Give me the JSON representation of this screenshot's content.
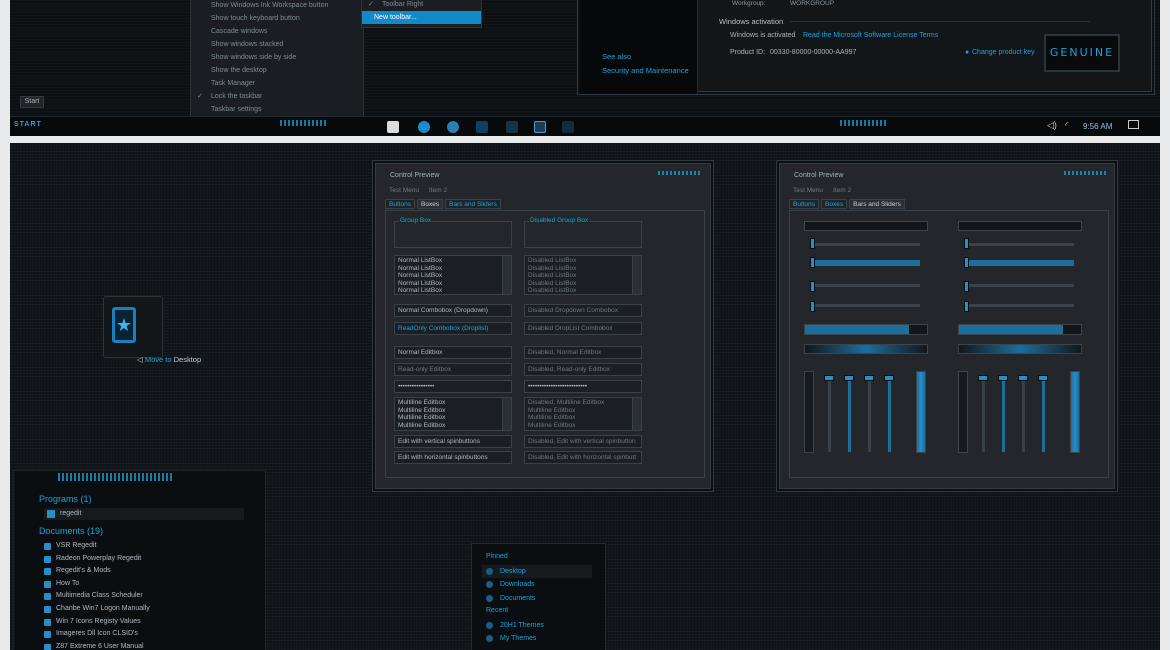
{
  "context_menu": {
    "items": [
      {
        "label": "Show Windows Ink Workspace button",
        "checked": false
      },
      {
        "label": "Show touch keyboard button",
        "checked": false
      },
      {
        "label": "Cascade windows",
        "checked": false
      },
      {
        "label": "Show windows stacked",
        "checked": false
      },
      {
        "label": "Show windows side by side",
        "checked": false
      },
      {
        "label": "Show the desktop",
        "checked": false
      },
      {
        "label": "Task Manager",
        "checked": false
      },
      {
        "label": "Lock the taskbar",
        "checked": true
      },
      {
        "label": "Taskbar settings",
        "checked": false
      }
    ],
    "check_mark": "✓"
  },
  "submenu": {
    "items": [
      {
        "label": "Toolbar Right",
        "checked": true
      },
      {
        "label": "New toolbar...",
        "highlighted": true
      }
    ]
  },
  "start_tooltip": "Start",
  "taskbar": {
    "start_label": "START",
    "time": "9:56 AM"
  },
  "system": {
    "workgroup_label": "Workgroup:",
    "workgroup_value": "WORKGROUP",
    "see_also": "See also",
    "security_link": "Security and Maintenance",
    "activation_header": "Windows activation",
    "activation_status": "Windows is activated",
    "license_link": "Read the Microsoft Software License Terms",
    "product_id_label": "Product ID:",
    "product_id": "00330-80000-00000-AA997",
    "change_key": "Change product key",
    "genuine": "GENUINE"
  },
  "desktop_icon": {
    "label": "Move to Desktop",
    "move_word": "Move to",
    "dest_word": "Desktop"
  },
  "preview1": {
    "title": "Control Preview",
    "menu": [
      "Test Menu",
      "Item 2"
    ],
    "tabs": [
      "Buttons",
      "Boxes",
      "Bars and Sliders"
    ],
    "group_box": "Group Box",
    "disabled_group_box": "Disabled Group Box",
    "normal_listbox_items": [
      "Normal ListBox",
      "Normal ListBox",
      "Normal ListBox",
      "Normal ListBox",
      "Normal ListBox"
    ],
    "disabled_listbox_items": [
      "Disabled ListBox",
      "Disabled ListBox",
      "Disabled ListBox",
      "Disabled ListBox",
      "Disabled ListBox"
    ],
    "combo_normal": "Normal Combobox (Dropdown)",
    "combo_disabled": "Disabled Dropdown Combobox",
    "combo_readonly": "ReadOnly Combobox (Droplist)",
    "combo_disabled_droplist": "Disabled DropList Combobox",
    "edit_normal": "Normal Editbox",
    "edit_disabled": "Disabled, Normal Editbox",
    "edit_readonly": "Read-only Editbox",
    "edit_disabled_readonly": "Disabled, Read-only Editbox",
    "password": "••••••••••••••••",
    "password_disabled": "••••••••••••••••••••••••••",
    "multiline_items": [
      "Multiline Editbox",
      "Multiline Editbox",
      "Multiline Editbox",
      "Multiline Editbox"
    ],
    "multiline_disabled_items": [
      "Disabled, Multiline Editbox",
      "Multiline Editbox",
      "Multiline Editbox",
      "Multiline Editbox"
    ],
    "spin_vertical": "Edit with vertical spinbuttons",
    "spin_vertical_disabled": "Disabled, Edit with vertical spinbutton",
    "spin_horizontal": "Edit with horizontal spinbuttons",
    "spin_horizontal_disabled": "Disabled, Edit with horizontal spinbutt"
  },
  "preview2": {
    "title": "Control Preview",
    "menu": [
      "Test Menu",
      "Item 2"
    ],
    "tabs": [
      "Buttons",
      "Boxes",
      "Bars and Sliders"
    ],
    "progress_fill": 0.85
  },
  "search_results": {
    "programs_header": "Programs (1)",
    "program_items": [
      "regedit"
    ],
    "documents_header": "Documents (19)",
    "document_items": [
      "VSR Regedit",
      "Radeon Powerplay Regedit",
      "Regedit's & Mods",
      "How To",
      "Multimedia Class Scheduler",
      "Chanbe Win7 Logon Manually",
      "Win 7 Icons Registy Values",
      "Imageres Dll Icon CLSID's",
      "Z87 Extreme 6 User Manual"
    ]
  },
  "jumplist": {
    "pinned_header": "Pinned",
    "pinned_items": [
      "Desktop",
      "Downloads",
      "Documents"
    ],
    "recent_header": "Recent",
    "recent_items": [
      "20H1 Themes",
      "My Themes"
    ]
  },
  "colors": {
    "accent": "#1aa3dd",
    "highlight": "#1389c8",
    "background": "#10151a"
  }
}
